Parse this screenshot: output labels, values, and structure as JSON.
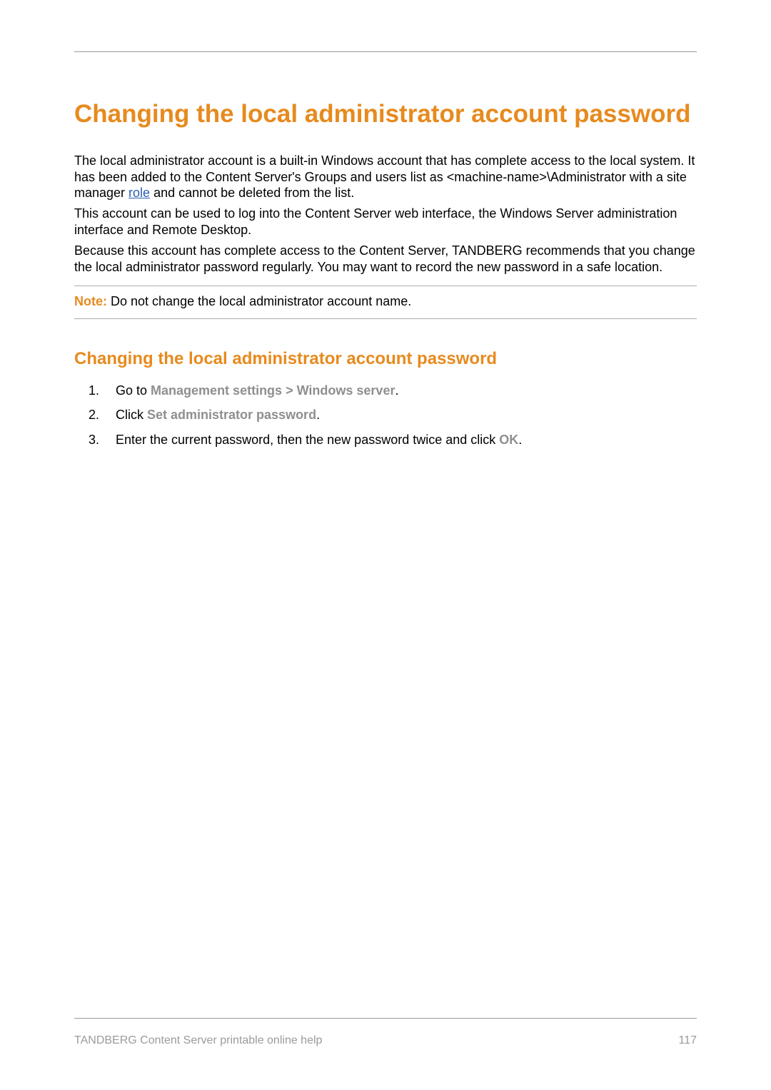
{
  "title": "Changing the local administrator account password",
  "paragraphs": {
    "p1_a": "The local administrator account is a built-in Windows account that has complete access to the local system. It has been added to the Content Server's Groups and users list as <machine-name>\\Administrator with a site manager ",
    "p1_link": "role",
    "p1_b": " and cannot be deleted from the list.",
    "p2": "This account can be used to log into the Content Server web interface, the Windows Server administration interface and Remote Desktop.",
    "p3": "Because this account has complete access to the Content Server, TANDBERG recommends that you change the local administrator password regularly. You may want to record the new password in a safe location."
  },
  "note": {
    "label": "Note:",
    "text": " Do not change the local administrator account name."
  },
  "subhead": "Changing the local administrator account password",
  "steps": {
    "s1_a": "Go to ",
    "s1_ui": "Management settings > Windows server",
    "s1_b": ".",
    "s2_a": "Click ",
    "s2_ui": "Set administrator password",
    "s2_b": ".",
    "s3_a": "Enter the current password, then the new password twice and click ",
    "s3_ui": "OK",
    "s3_b": "."
  },
  "footer": {
    "left": "TANDBERG Content Server printable online help",
    "right": "117"
  }
}
